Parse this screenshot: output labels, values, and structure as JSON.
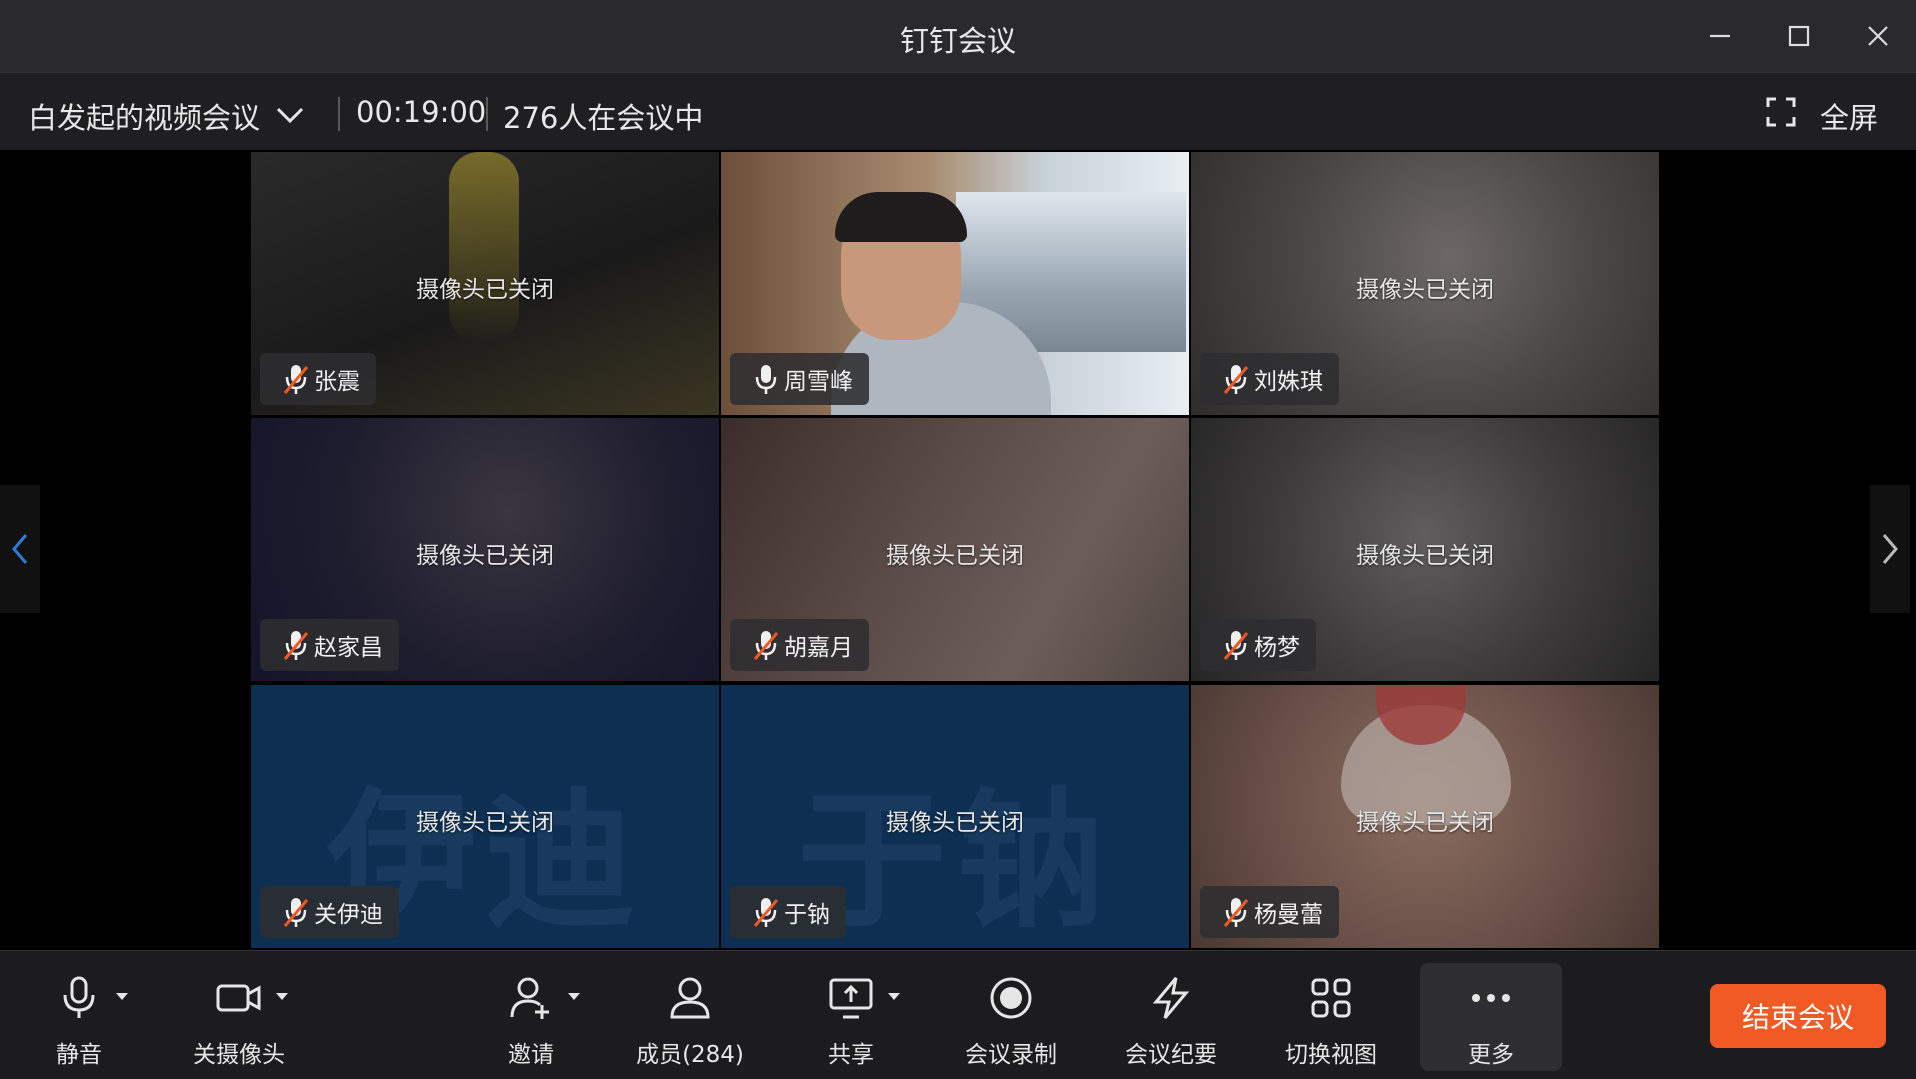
{
  "window": {
    "title": "钉钉会议"
  },
  "infobar": {
    "meeting_name": "白发起的视频会议",
    "timer": "00:19:00",
    "participants_text": "276人在会议中",
    "fullscreen_label": "全屏"
  },
  "tiles": [
    {
      "name": "张震",
      "status": "摄像头已关闭",
      "muted": true
    },
    {
      "name": "周雪峰",
      "status": "",
      "muted": false
    },
    {
      "name": "刘姝琪",
      "status": "摄像头已关闭",
      "muted": true
    },
    {
      "name": "赵家昌",
      "status": "摄像头已关闭",
      "muted": true
    },
    {
      "name": "胡嘉月",
      "status": "摄像头已关闭",
      "muted": true
    },
    {
      "name": "杨梦",
      "status": "摄像头已关闭",
      "muted": true
    },
    {
      "name": "关伊迪",
      "status": "摄像头已关闭",
      "muted": true,
      "avatar_text": "伊迪"
    },
    {
      "name": "于钠",
      "status": "摄像头已关闭",
      "muted": true,
      "avatar_text": "于钠"
    },
    {
      "name": "杨曼蕾",
      "status": "摄像头已关闭",
      "muted": true
    }
  ],
  "toolbar": {
    "mute": "静音",
    "camera": "关摄像头",
    "invite": "邀请",
    "members": "成员(284)",
    "share": "共享",
    "record": "会议录制",
    "minutes": "会议纪要",
    "switch_view": "切换视图",
    "more": "更多",
    "end_meeting": "结束会议"
  },
  "colors": {
    "end_button": "#f15a24",
    "muted_mic": "#f15a24",
    "avatar_tile": "#0d2f52"
  }
}
